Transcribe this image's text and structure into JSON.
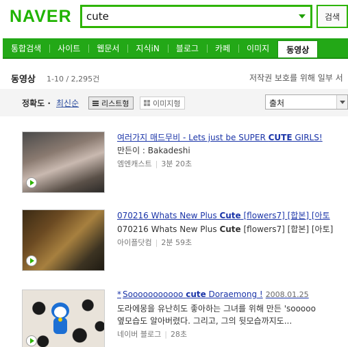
{
  "header": {
    "logo": "NAVER",
    "search_value": "cute",
    "search_button": "검색",
    "brand_color": "#2db400"
  },
  "tabs": [
    {
      "label": "통합검색",
      "active": false
    },
    {
      "label": "사이트",
      "active": false
    },
    {
      "label": "웹문서",
      "active": false
    },
    {
      "label": "지식iN",
      "active": false
    },
    {
      "label": "블로그",
      "active": false
    },
    {
      "label": "카페",
      "active": false
    },
    {
      "label": "이미지",
      "active": false
    },
    {
      "label": "동영상",
      "active": true
    }
  ],
  "section": {
    "title": "동영상",
    "count": "1-10 / 2,295건",
    "notice": "저작권 보호를 위해 일부 서"
  },
  "filters": {
    "sort_accuracy": "정확도",
    "sort_separator": "·",
    "sort_recent": "최신순",
    "view_list": "리스트형",
    "view_image": "이미지형",
    "source_select": "출처"
  },
  "results": [
    {
      "title_prefix": "여러가지 매드무비 - Lets just be SUPER ",
      "title_highlight": "CUTE",
      "title_suffix": " GIRLS!",
      "date": "",
      "desc_prefix": "만든이 : Bakadeshi",
      "desc_highlight": "",
      "desc_suffix": "",
      "source": "엠엔캐스트",
      "duration": "3분 20초"
    },
    {
      "title_prefix": "070216 Whats New Plus ",
      "title_highlight": "Cute",
      "title_suffix": " [flowers7] [합본] [아토",
      "date": "",
      "desc_prefix": "070216 Whats New Plus ",
      "desc_highlight": "Cute",
      "desc_suffix": " [flowers7] [합본] [아토]",
      "source": "아이플닷컴",
      "duration": "2분 59초"
    },
    {
      "title_prefix": "Sooooooooooo ",
      "title_highlight": "cute",
      "title_suffix": " Doraemong !",
      "date": "2008.01.25",
      "desc_prefix": "도라에몽을 유난히도 좋아하는 그녀를 위해 만든 'sooooo",
      "desc_line2": "옆모습도 알아버렸다. 그리고, 그의 뒷모습까지도...",
      "desc_highlight": "",
      "desc_suffix": "",
      "source": "네이버 블로그",
      "duration": "28초"
    }
  ]
}
